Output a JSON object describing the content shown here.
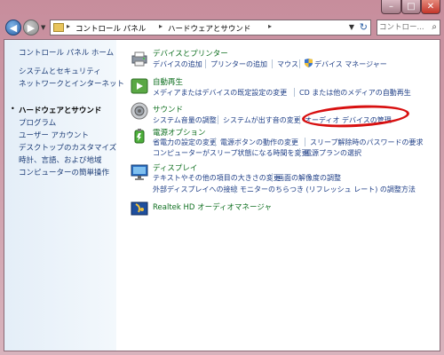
{
  "window": {
    "controls": {
      "minimize": "–",
      "maximize": "□",
      "close": "✕"
    }
  },
  "address": {
    "breadcrumbs": [
      "コントロール パネル",
      "ハードウェアとサウンド"
    ],
    "search_placeholder": "コントロー..."
  },
  "sidebar": {
    "items": [
      {
        "label": "コントロール パネル ホーム",
        "current": false
      },
      {
        "label": "システムとセキュリティ",
        "current": false
      },
      {
        "label": "ネットワークとインターネット",
        "current": false
      },
      {
        "label": "ハードウェアとサウンド",
        "current": true
      },
      {
        "label": "プログラム",
        "current": false
      },
      {
        "label": "ユーザー アカウント",
        "current": false
      },
      {
        "label": "デスクトップのカスタマイズ",
        "current": false
      },
      {
        "label": "時計、言語、および地域",
        "current": false
      },
      {
        "label": "コンピューターの簡単操作",
        "current": false
      }
    ]
  },
  "categories": [
    {
      "title": "デバイスとプリンター",
      "icon": "printer-icon",
      "links": [
        "デバイスの追加",
        "プリンターの追加",
        "マウス",
        "デバイス マネージャー"
      ]
    },
    {
      "title": "自動再生",
      "icon": "autoplay-icon",
      "links": [
        "メディアまたはデバイスの既定設定の変更",
        "CD または他のメディアの自動再生"
      ]
    },
    {
      "title": "サウンド",
      "icon": "speaker-icon",
      "links": [
        "システム音量の調整",
        "システムが出す音の変更",
        "オーディオ デバイスの管理"
      ]
    },
    {
      "title": "電源オプション",
      "icon": "battery-icon",
      "links": [
        "省電力の設定の変更",
        "電源ボタンの動作の変更",
        "スリープ解除時のパスワードの要求",
        "コンピューターがスリープ状態になる時間を変更",
        "電源プランの選択"
      ]
    },
    {
      "title": "ディスプレイ",
      "icon": "monitor-icon",
      "links": [
        "テキストやその他の項目の大きさの変更",
        "画面の解像度の調整",
        "外部ディスプレイへの接続",
        "モニターのちらつき (リフレッシュ レート) の調整方法"
      ]
    },
    {
      "title": "Realtek HD オーディオマネージャ",
      "icon": "realtek-icon",
      "links": []
    }
  ],
  "colors": {
    "link": "#1e3e86",
    "category_title": "#107021",
    "highlight_ellipse": "#d81010"
  }
}
